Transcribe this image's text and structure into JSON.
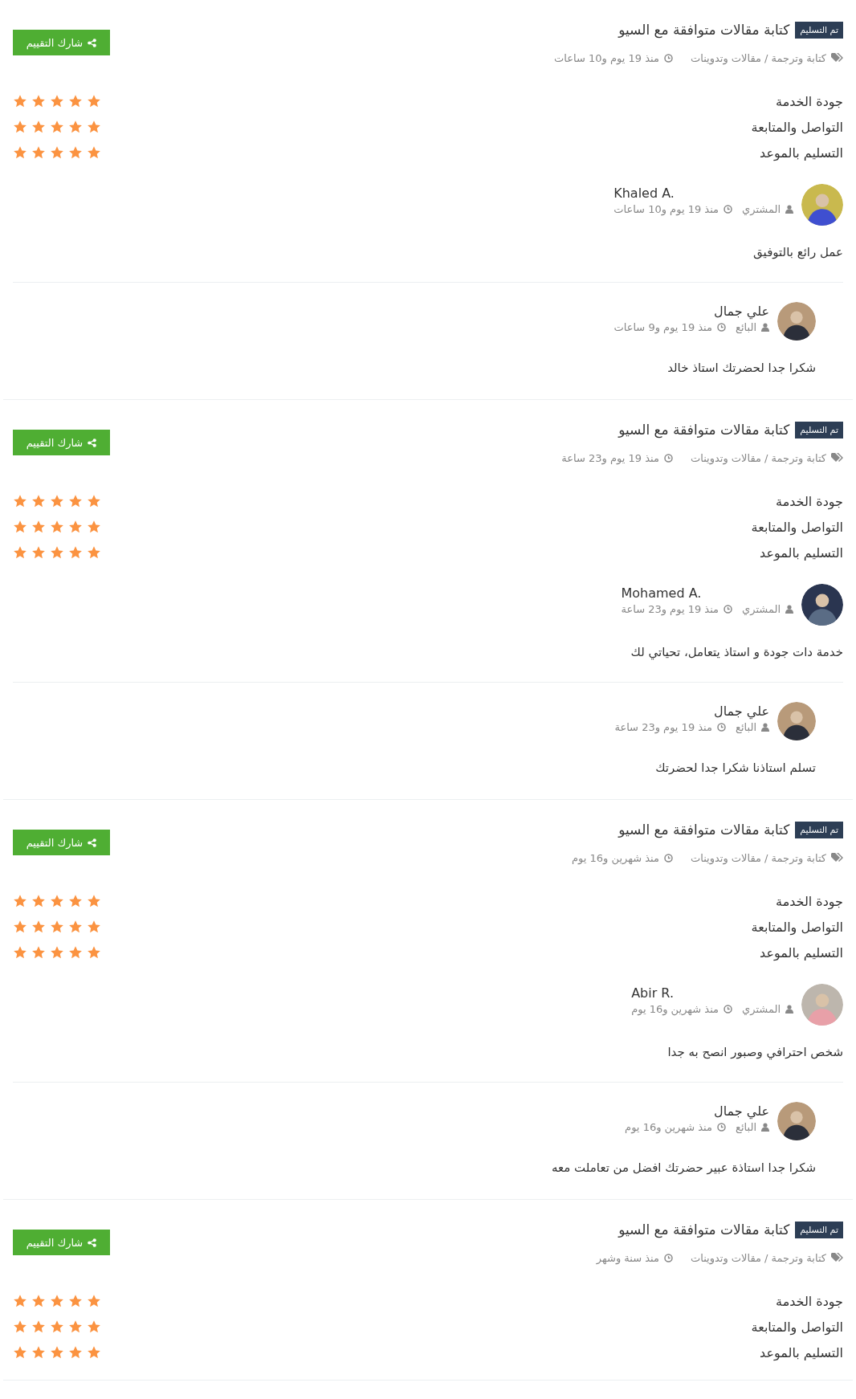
{
  "reviews": [
    {
      "status": "تم التسليم",
      "title": "كتابة مقالات متوافقة مع السيو",
      "category": "كتابة وترجمة / مقالات وتدوينات",
      "time": "منذ 19 يوم و10 ساعات",
      "share_button": "شارك التقييم",
      "ratings": [
        {
          "label": "جودة الخدمة",
          "stars": 5
        },
        {
          "label": "التواصل والمتابعة",
          "stars": 5
        },
        {
          "label": "التسليم بالموعد",
          "stars": 5
        }
      ],
      "buyer": {
        "name": "Khaled A.",
        "role": "المشتري",
        "time": "منذ 19 يوم و10 ساعات",
        "comment": "عمل رائع بالتوفيق"
      },
      "reply": {
        "name": "علي جمال",
        "role": "البائع",
        "time": "منذ 19 يوم و9 ساعات",
        "text": "شكرا جدا لحضرتك استاذ خالد"
      }
    },
    {
      "status": "تم التسليم",
      "title": "كتابة مقالات متوافقة مع السيو",
      "category": "كتابة وترجمة / مقالات وتدوينات",
      "time": "منذ 19 يوم و23 ساعة",
      "share_button": "شارك التقييم",
      "ratings": [
        {
          "label": "جودة الخدمة",
          "stars": 5
        },
        {
          "label": "التواصل والمتابعة",
          "stars": 5
        },
        {
          "label": "التسليم بالموعد",
          "stars": 5
        }
      ],
      "buyer": {
        "name": "Mohamed A.",
        "role": "المشتري",
        "time": "منذ 19 يوم و23 ساعة",
        "comment": "خدمة دات جودة و استاذ يتعامل، تحياتي لك"
      },
      "reply": {
        "name": "علي جمال",
        "role": "البائع",
        "time": "منذ 19 يوم و23 ساعة",
        "text": "تسلم استاذنا شكرا جدا لحضرتك"
      }
    },
    {
      "status": "تم التسليم",
      "title": "كتابة مقالات متوافقة مع السيو",
      "category": "كتابة وترجمة / مقالات وتدوينات",
      "time": "منذ شهرين و16 يوم",
      "share_button": "شارك التقييم",
      "ratings": [
        {
          "label": "جودة الخدمة",
          "stars": 5
        },
        {
          "label": "التواصل والمتابعة",
          "stars": 5
        },
        {
          "label": "التسليم بالموعد",
          "stars": 5
        }
      ],
      "buyer": {
        "name": "Abir R.",
        "role": "المشتري",
        "time": "منذ شهرين و16 يوم",
        "comment": "شخص احترافي وصبور انصح به جدا"
      },
      "reply": {
        "name": "علي جمال",
        "role": "البائع",
        "time": "منذ شهرين و16 يوم",
        "text": "شكرا جدا استاذة عبير حضرتك افضل من تعاملت معه"
      }
    },
    {
      "status": "تم التسليم",
      "title": "كتابة مقالات متوافقة مع السيو",
      "category": "كتابة وترجمة / مقالات وتدوينات",
      "time": "منذ سنة وشهر",
      "share_button": "شارك التقييم",
      "ratings": [
        {
          "label": "جودة الخدمة",
          "stars": 5
        },
        {
          "label": "التواصل والمتابعة",
          "stars": 5
        },
        {
          "label": "التسليم بالموعد",
          "stars": 5
        }
      ]
    }
  ]
}
